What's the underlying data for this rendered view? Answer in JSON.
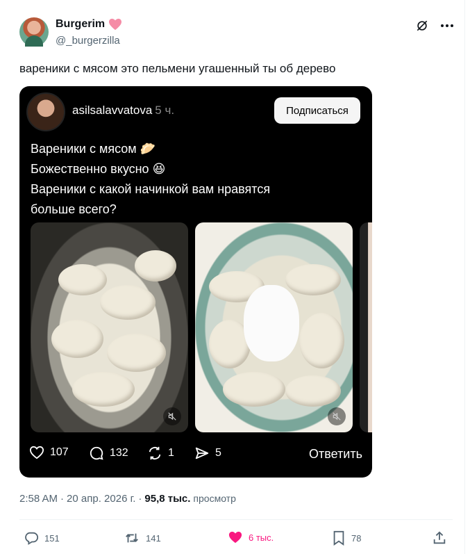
{
  "author": {
    "name": "Burgerim",
    "handle": "@_burgerzilla"
  },
  "tweet_text": "вареники с мясом это пельмени угашенный ты об дерево",
  "quoted_post": {
    "username": "asilsalavvatova",
    "time": "5 ч.",
    "subscribe_label": "Подписаться",
    "caption_lines": [
      "Вареники с мясом 🥟",
      "Божественно вкусно 😆",
      "Вареники с какой начинкой вам нравятся",
      "больше всего?"
    ],
    "actions": {
      "likes": "107",
      "comments": "132",
      "reposts": "1",
      "shares": "5",
      "reply_label": "Ответить"
    }
  },
  "meta": {
    "time": "2:58 AM",
    "separator": "·",
    "date": "20 апр. 2026 г.",
    "separator2": "·",
    "views": "95,8 тыс.",
    "views_label": "просмотр"
  },
  "engagement": {
    "replies": "151",
    "reposts": "141",
    "likes": "6 тыс.",
    "bookmarks": "78"
  },
  "colors": {
    "like_pink": "#f91880",
    "muted_text": "#536471",
    "card_bg": "#000000"
  }
}
